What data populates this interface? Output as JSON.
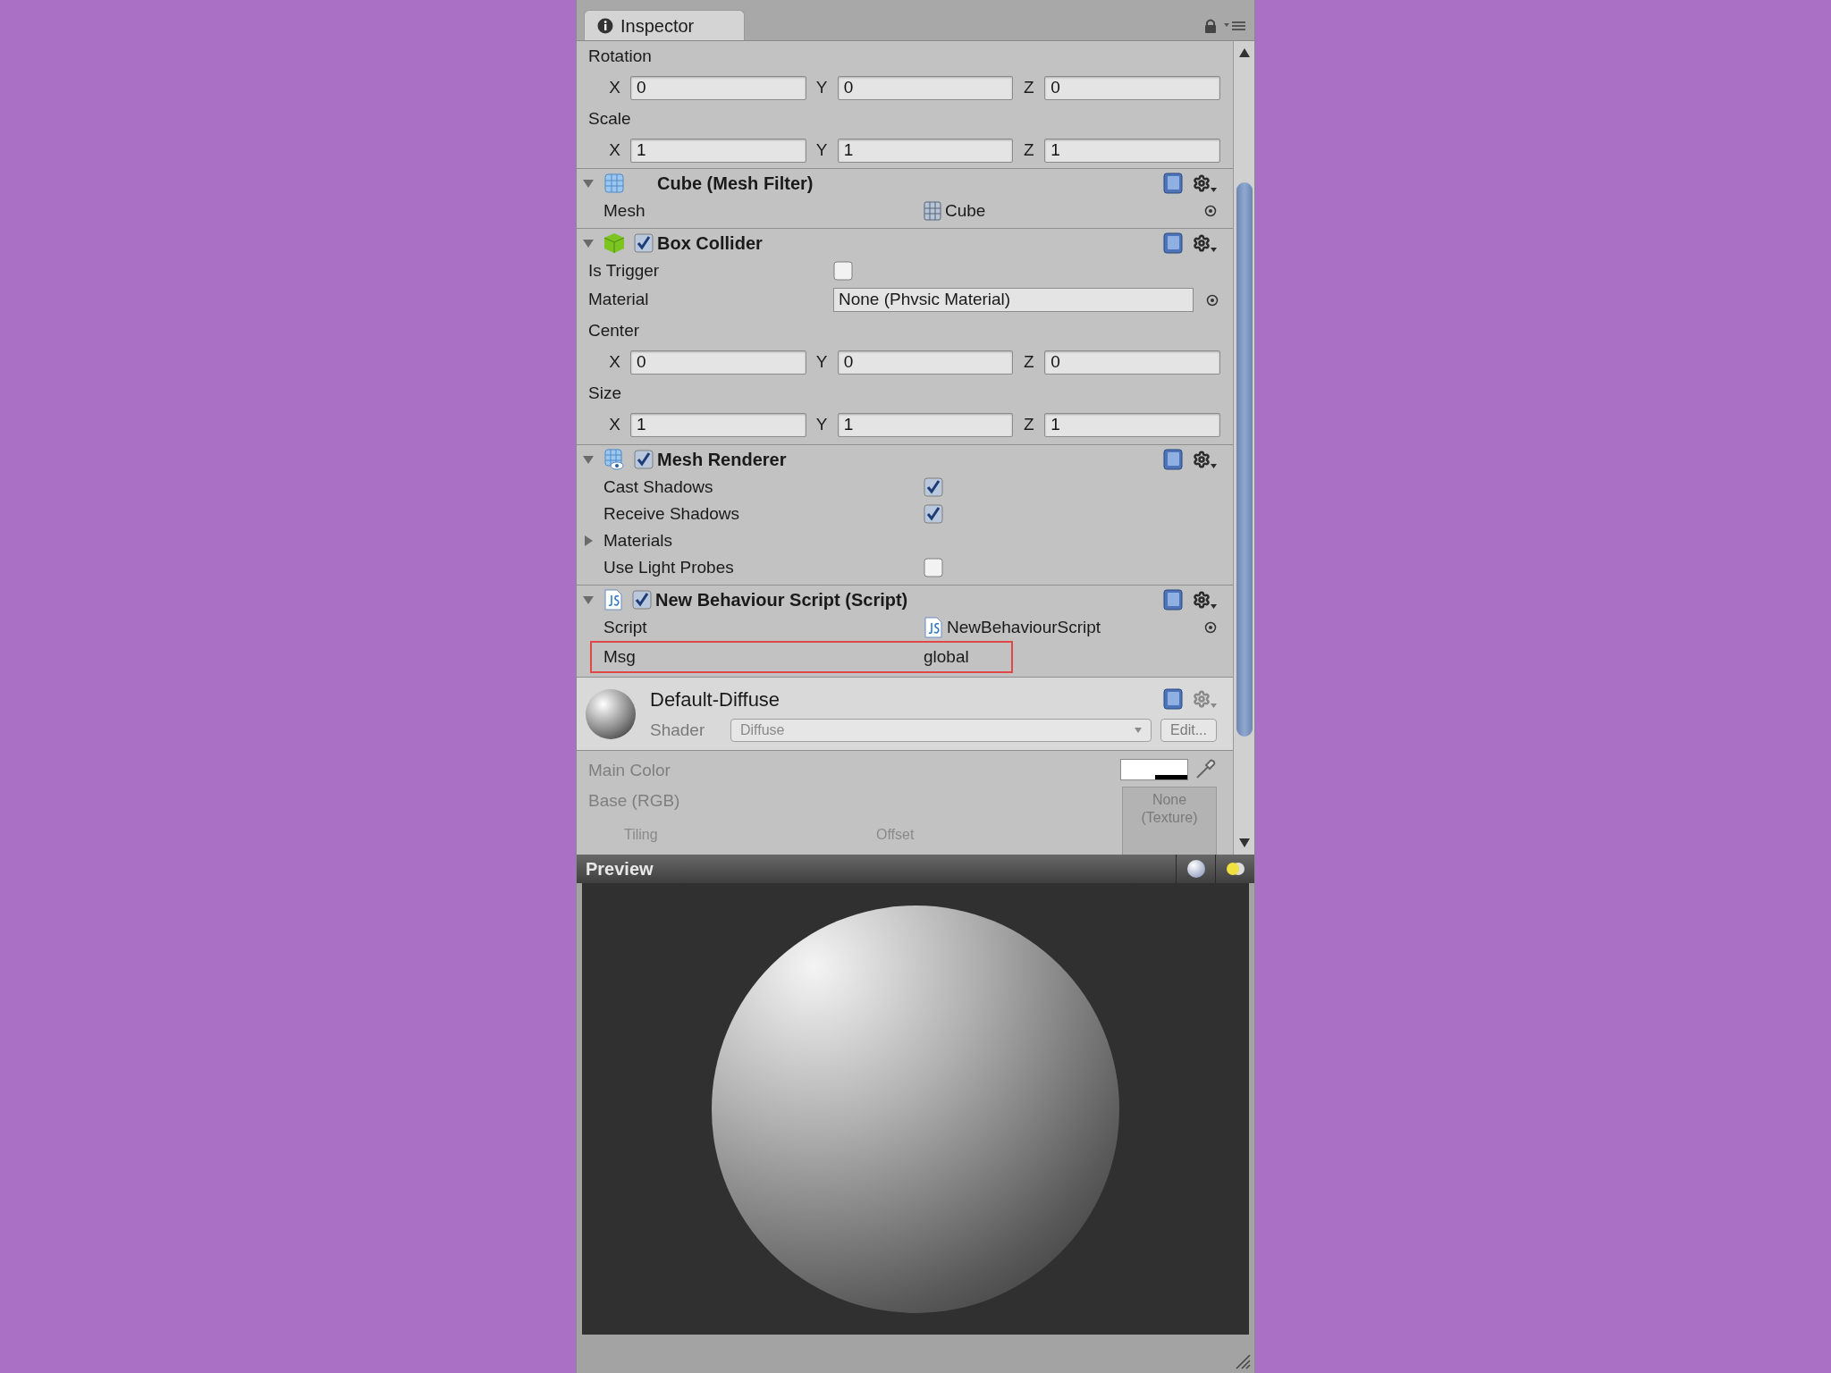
{
  "tab": {
    "title": "Inspector"
  },
  "transform": [
    {
      "label": "Rotation",
      "values": [
        {
          "axis": "X",
          "value": "0"
        },
        {
          "axis": "Y",
          "value": "0"
        },
        {
          "axis": "Z",
          "value": "0"
        }
      ]
    },
    {
      "label": "Scale",
      "values": [
        {
          "axis": "X",
          "value": "1"
        },
        {
          "axis": "Y",
          "value": "1"
        },
        {
          "axis": "Z",
          "value": "1"
        }
      ]
    }
  ],
  "components": [
    {
      "kind": "mesh_filter",
      "title": "Cube (Mesh Filter)",
      "expanded": true,
      "properties": [
        {
          "kind": "object",
          "label": "Mesh",
          "value": "Cube"
        }
      ]
    },
    {
      "kind": "box_collider",
      "title": "Box Collider",
      "expanded": true,
      "enabled": true,
      "properties": [
        {
          "kind": "toggle",
          "label": "Is Trigger",
          "checked": false
        },
        {
          "kind": "object_field",
          "label": "Material",
          "value": "None (Phvsic Material)"
        },
        {
          "kind": "vector",
          "label": "Center",
          "values": [
            {
              "axis": "X",
              "value": "0"
            },
            {
              "axis": "Y",
              "value": "0"
            },
            {
              "axis": "Z",
              "value": "0"
            }
          ]
        },
        {
          "kind": "vector",
          "label": "Size",
          "values": [
            {
              "axis": "X",
              "value": "1"
            },
            {
              "axis": "Y",
              "value": "1"
            },
            {
              "axis": "Z",
              "value": "1"
            }
          ]
        }
      ]
    },
    {
      "kind": "mesh_renderer",
      "title": "Mesh Renderer",
      "expanded": true,
      "enabled": true,
      "properties": [
        {
          "kind": "toggle",
          "label": "Cast Shadows",
          "checked": true
        },
        {
          "kind": "toggle",
          "label": "Receive Shadows",
          "checked": true
        },
        {
          "kind": "foldout",
          "label": "Materials",
          "expanded": false
        },
        {
          "kind": "toggle",
          "label": "Use Light Probes",
          "checked": false
        }
      ]
    },
    {
      "kind": "script",
      "title": "New Behaviour Script (Script)",
      "expanded": true,
      "enabled": true,
      "properties": [
        {
          "kind": "object",
          "label": "Script",
          "value": "NewBehaviourScript"
        },
        {
          "kind": "text",
          "label": "Msg",
          "value": "global",
          "highlighted": true
        }
      ]
    }
  ],
  "material": {
    "name": "Default-Diffuse",
    "shader_label": "Shader",
    "shader": "Diffuse",
    "edit_button": "Edit...",
    "color_label": "Main Color",
    "texture_label": "Base (RGB)",
    "texture_slot": "None (Texture)",
    "tiling": "Tiling",
    "offset": "Offset"
  },
  "preview": {
    "title": "Preview"
  }
}
